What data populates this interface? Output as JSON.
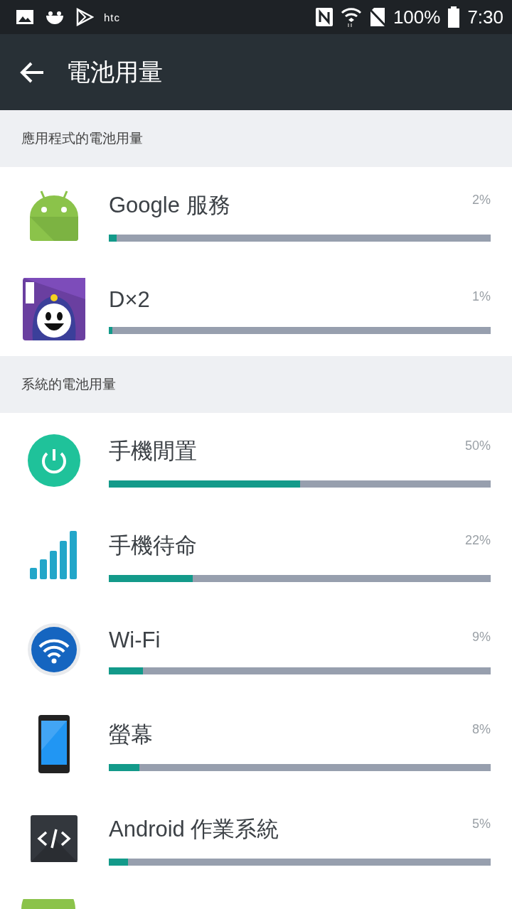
{
  "status_bar": {
    "notification_text": "htc",
    "battery": "100%",
    "time": "7:30"
  },
  "toolbar": {
    "title": "電池用量"
  },
  "sections": [
    {
      "header": "應用程式的電池用量",
      "items": [
        {
          "kind": "android",
          "name": "Google 服務",
          "percent": "2%",
          "level": 0.02
        },
        {
          "kind": "game",
          "name": "D×2",
          "percent": "1%",
          "level": 0.01
        }
      ]
    },
    {
      "header": "系統的電池用量",
      "items": [
        {
          "kind": "power",
          "name": "手機閒置",
          "percent": "50%",
          "level": 0.5
        },
        {
          "kind": "signal",
          "name": "手機待命",
          "percent": "22%",
          "level": 0.22
        },
        {
          "kind": "wifi",
          "name": "Wi-Fi",
          "percent": "9%",
          "level": 0.09
        },
        {
          "kind": "phone",
          "name": "螢幕",
          "percent": "8%",
          "level": 0.08
        },
        {
          "kind": "code",
          "name": "Android 作業系統",
          "percent": "5%",
          "level": 0.05
        },
        {
          "kind": "cut"
        }
      ]
    }
  ]
}
